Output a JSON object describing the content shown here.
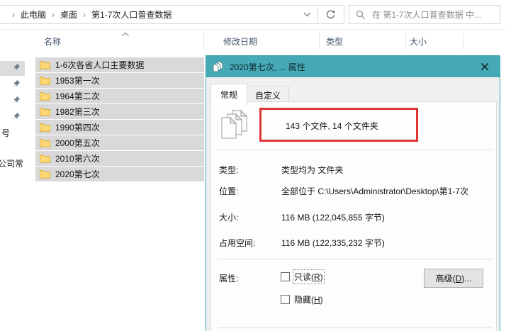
{
  "explorer": {
    "breadcrumb": {
      "separator": "›",
      "items": [
        "此电脑",
        "桌面",
        "第1-7次人口普查数据"
      ]
    },
    "search_placeholder": "在 第1-7次人口普查数据 中...",
    "columns": {
      "name": "名称",
      "modified": "修改日期",
      "type": "类型",
      "size": "大小"
    },
    "folders": [
      "1-6次各省人口主要数据",
      "1953第一次",
      "1964第二次",
      "1982第三次",
      "1990第四次",
      "2000第五次",
      "2010第六次",
      "2020第七次"
    ],
    "nav_fragments": [
      "号",
      "公司常"
    ]
  },
  "dialog": {
    "title": "2020第七次, ... 属性",
    "close_glyph": "×",
    "tabs": {
      "general": "常规",
      "custom": "自定义"
    },
    "summary": "143 个文件, 14 个文件夹",
    "rows": [
      {
        "label": "类型:",
        "value": "类型均为 文件夹"
      },
      {
        "label": "位置:",
        "value": "全部位于 C:\\Users\\Administrator\\Desktop\\第1-7次"
      },
      {
        "label": "大小:",
        "value": "116 MB (122,045,855 字节)"
      },
      {
        "label": "占用空间:",
        "value": "116 MB (122,335,232 字节)"
      }
    ],
    "attributes": {
      "label": "属性:",
      "readonly": {
        "pre": "只读(",
        "accel": "R",
        "post": ")"
      },
      "hidden": {
        "pre": "隐藏(",
        "accel": "H",
        "post": ")"
      },
      "advanced": {
        "pre": "高级(",
        "accel": "D",
        "post": ")..."
      }
    }
  },
  "colors": {
    "titlebar_accent": "#46aab6",
    "selection_gray": "#d9d9d9",
    "annotation_red": "#e03434",
    "folder_yellow": "#ffd876"
  }
}
